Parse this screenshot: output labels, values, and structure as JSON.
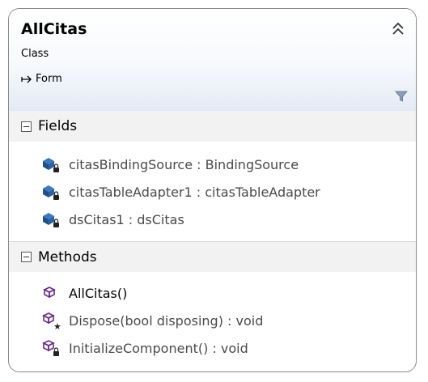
{
  "class_box": {
    "name": "AllCitas",
    "stereotype": "Class",
    "base_class": "Form"
  },
  "sections": {
    "fields": {
      "title": "Fields",
      "items": [
        {
          "label": "citasBindingSource : BindingSource",
          "icon": "private-field-icon"
        },
        {
          "label": "citasTableAdapter1 : citasTableAdapter",
          "icon": "private-field-icon"
        },
        {
          "label": "dsCitas1 : dsCitas",
          "icon": "private-field-icon"
        }
      ]
    },
    "methods": {
      "title": "Methods",
      "items": [
        {
          "label": "AllCitas()",
          "icon": "public-method-icon"
        },
        {
          "label": "Dispose(bool disposing) : void",
          "icon": "protected-method-icon"
        },
        {
          "label": "InitializeComponent() : void",
          "icon": "private-method-icon"
        }
      ]
    }
  },
  "colors": {
    "field_icon": "#1f5b99",
    "method_icon": "#6a2a8a",
    "border": "#8a8a8a",
    "header_gradient_end": "#e3eaf5"
  }
}
